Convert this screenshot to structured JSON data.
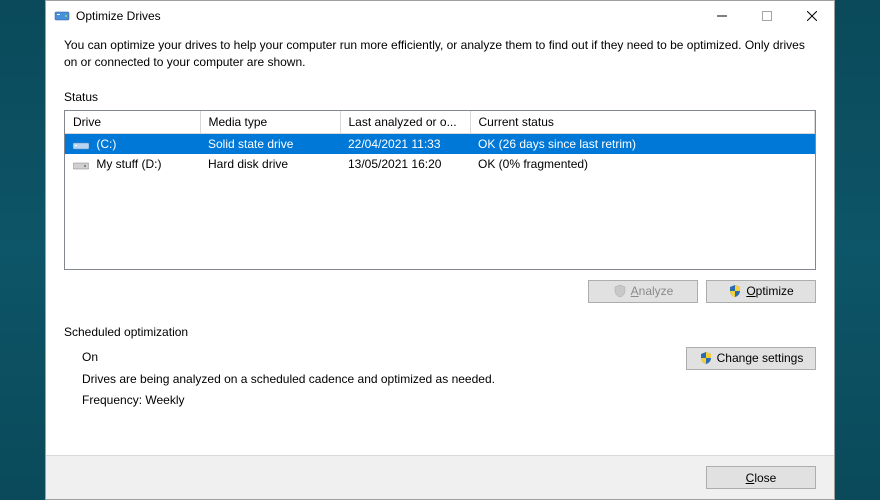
{
  "window": {
    "title": "Optimize Drives"
  },
  "intro": "You can optimize your drives to help your computer run more efficiently, or analyze them to find out if they need to be optimized. Only drives on or connected to your computer are shown.",
  "status_label": "Status",
  "columns": {
    "drive": "Drive",
    "media": "Media type",
    "last": "Last analyzed or o...",
    "status": "Current status"
  },
  "drives": [
    {
      "name": "(C:)",
      "media": "Solid state drive",
      "last": "22/04/2021 11:33",
      "status": "OK (26 days since last retrim)",
      "selected": true
    },
    {
      "name": "My stuff (D:)",
      "media": "Hard disk drive",
      "last": "13/05/2021 16:20",
      "status": "OK (0% fragmented)",
      "selected": false
    }
  ],
  "buttons": {
    "analyze": "Analyze",
    "optimize": "Optimize",
    "change": "Change settings",
    "close": "Close"
  },
  "sched": {
    "label": "Scheduled optimization",
    "on": "On",
    "desc": "Drives are being analyzed on a scheduled cadence and optimized as needed.",
    "freq_label": "Frequency:",
    "freq_value": "Weekly"
  }
}
